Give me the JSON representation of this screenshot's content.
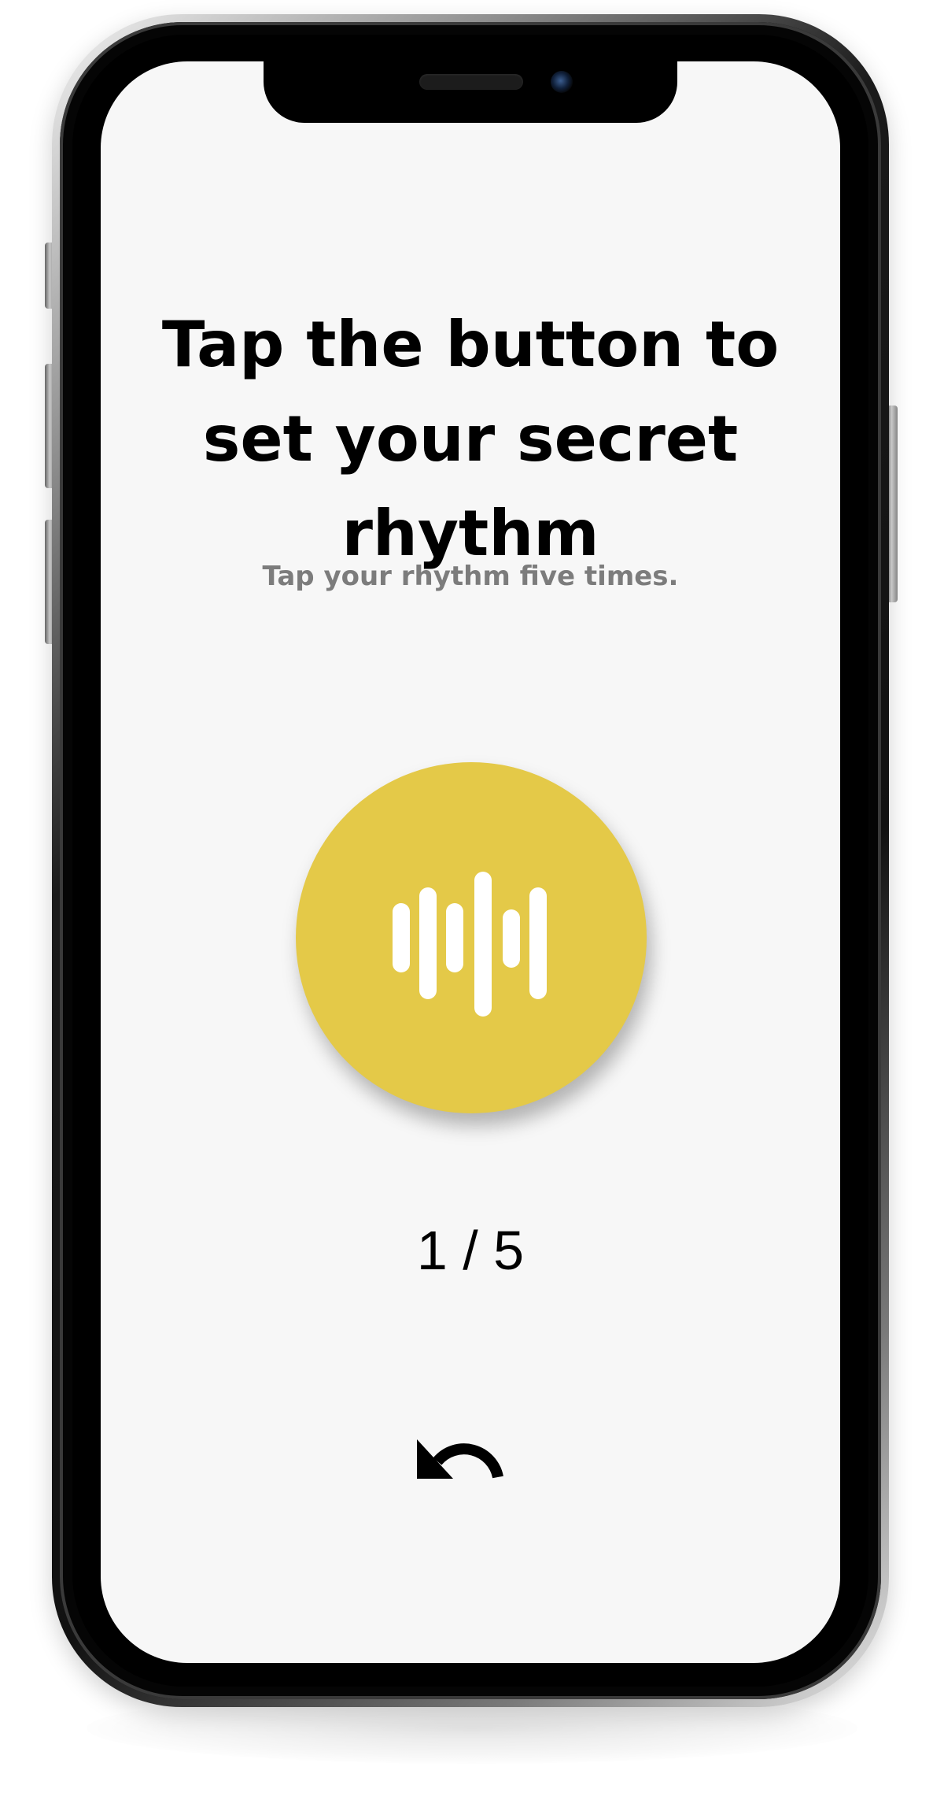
{
  "screen": {
    "title": "Tap the button to set your secret rhythm",
    "subtitle": "Tap your rhythm five times.",
    "progress": {
      "current": 1,
      "total": 5,
      "label": "1 / 5"
    }
  },
  "rhythm_button": {
    "icon": "waveform-icon",
    "color": "#e4c948",
    "icon_color": "#ffffff"
  },
  "undo_button": {
    "icon": "undo-icon"
  },
  "colors": {
    "screen_background": "#f7f7f7",
    "title": "#000000",
    "subtitle": "#7c7c7c"
  }
}
